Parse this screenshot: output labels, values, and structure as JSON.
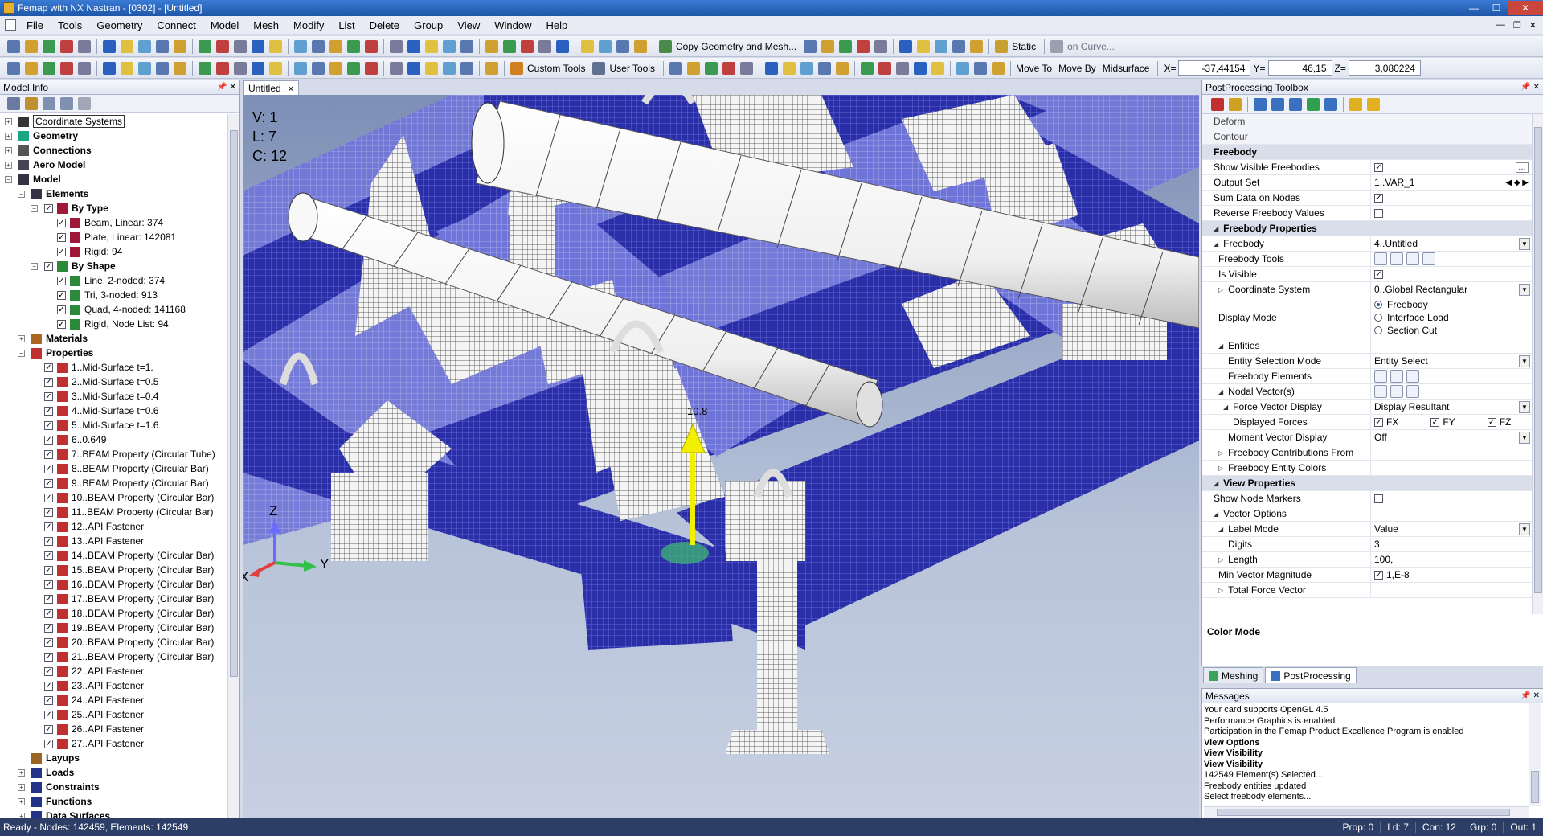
{
  "window": {
    "title": "Femap with NX Nastran - [0302] - [Untitled]"
  },
  "menu": [
    "File",
    "Tools",
    "Geometry",
    "Connect",
    "Model",
    "Mesh",
    "Modify",
    "List",
    "Delete",
    "Group",
    "View",
    "Window",
    "Help"
  ],
  "toolbar": {
    "copy_geometry": "Copy Geometry and Mesh...",
    "static": "Static",
    "on_curve": "on Curve...",
    "custom_tools": "Custom Tools",
    "user_tools": "User Tools",
    "move_to": "Move To",
    "move_by": "Move By",
    "midsurface": "Midsurface",
    "x_label": "X=",
    "x_value": "-37,44154",
    "y_label": "Y=",
    "y_value": "46,15",
    "z_label": "Z=",
    "z_value": "3,080224"
  },
  "model_info": {
    "title": "Model Info",
    "tree": [
      {
        "level": 0,
        "exp": "+",
        "label": "Coordinate Systems",
        "bold": false,
        "box": true,
        "icon": "coord-icon",
        "color": "#333"
      },
      {
        "level": 0,
        "exp": "+",
        "label": "Geometry",
        "bold": true,
        "icon": "geometry-icon",
        "color": "#1aa884"
      },
      {
        "level": 0,
        "exp": "+",
        "label": "Connections",
        "bold": true,
        "icon": "connections-icon",
        "color": "#555"
      },
      {
        "level": 0,
        "exp": "+",
        "label": "Aero Model",
        "bold": true,
        "icon": "aero-icon",
        "color": "#445"
      },
      {
        "level": 0,
        "exp": "-",
        "label": "Model",
        "bold": true,
        "icon": "model-icon",
        "color": "#334"
      },
      {
        "level": 1,
        "exp": "-",
        "label": "Elements",
        "bold": true,
        "icon": "elements-icon",
        "color": "#334"
      },
      {
        "level": 2,
        "exp": "-",
        "label": "By Type",
        "bold": true,
        "icon": "by-type-icon",
        "color": "#a01838",
        "cb": true
      },
      {
        "level": 3,
        "label": "Beam, Linear: 374",
        "cb": true,
        "icon": "beam-icon",
        "color": "#a01838"
      },
      {
        "level": 3,
        "label": "Plate, Linear: 142081",
        "cb": true,
        "icon": "plate-icon",
        "color": "#a01838"
      },
      {
        "level": 3,
        "label": "Rigid: 94",
        "cb": true,
        "icon": "rigid-icon",
        "color": "#a01838"
      },
      {
        "level": 2,
        "exp": "-",
        "label": "By Shape",
        "bold": true,
        "icon": "by-shape-icon",
        "color": "#2a8a3a",
        "cb": true
      },
      {
        "level": 3,
        "label": "Line, 2-noded: 374",
        "cb": true,
        "icon": "line-shape-icon",
        "color": "#2a8a3a"
      },
      {
        "level": 3,
        "label": "Tri,  3-noded: 913",
        "cb": true,
        "icon": "tri-shape-icon",
        "color": "#2a8a3a"
      },
      {
        "level": 3,
        "label": "Quad, 4-noded: 141168",
        "cb": true,
        "icon": "quad-shape-icon",
        "color": "#2a8a3a"
      },
      {
        "level": 3,
        "label": "Rigid, Node List: 94",
        "cb": true,
        "icon": "rigid-shape-icon",
        "color": "#2a8a3a"
      },
      {
        "level": 1,
        "exp": "+",
        "label": "Materials",
        "bold": true,
        "icon": "materials-icon",
        "color": "#aa6622"
      },
      {
        "level": 1,
        "exp": "-",
        "label": "Properties",
        "bold": true,
        "icon": "properties-icon",
        "color": "#c03030"
      },
      {
        "level": 2,
        "label": "1..Mid-Surface t=1.",
        "cb": true,
        "icon": "plate-prop-icon",
        "color": "#c03030"
      },
      {
        "level": 2,
        "label": "2..Mid-Surface t=0.5",
        "cb": true,
        "icon": "plate-prop-icon",
        "color": "#c03030"
      },
      {
        "level": 2,
        "label": "3..Mid-Surface t=0.4",
        "cb": true,
        "icon": "plate-prop-icon",
        "color": "#c03030"
      },
      {
        "level": 2,
        "label": "4..Mid-Surface t=0.6",
        "cb": true,
        "icon": "plate-prop-icon",
        "color": "#c03030"
      },
      {
        "level": 2,
        "label": "5..Mid-Surface t=1.6",
        "cb": true,
        "icon": "plate-prop-icon",
        "color": "#c03030"
      },
      {
        "level": 2,
        "label": "6..0.649",
        "cb": true,
        "icon": "plate-prop-icon",
        "color": "#c03030"
      },
      {
        "level": 2,
        "label": "7..BEAM Property (Circular Tube)",
        "cb": true,
        "icon": "tube-prop-icon",
        "color": "#c03030"
      },
      {
        "level": 2,
        "label": "8..BEAM Property (Circular Bar)",
        "cb": true,
        "icon": "bar-prop-icon",
        "color": "#c03030"
      },
      {
        "level": 2,
        "label": "9..BEAM Property (Circular Bar)",
        "cb": true,
        "icon": "bar-prop-icon",
        "color": "#c03030"
      },
      {
        "level": 2,
        "label": "10..BEAM Property (Circular Bar)",
        "cb": true,
        "icon": "bar-prop-icon",
        "color": "#c03030"
      },
      {
        "level": 2,
        "label": "11..BEAM Property (Circular Bar)",
        "cb": true,
        "icon": "bar-prop-icon",
        "color": "#c03030"
      },
      {
        "level": 2,
        "label": "12..API Fastener",
        "cb": true,
        "icon": "fastener-prop-icon",
        "color": "#c03030"
      },
      {
        "level": 2,
        "label": "13..API Fastener",
        "cb": true,
        "icon": "fastener-prop-icon",
        "color": "#c03030"
      },
      {
        "level": 2,
        "label": "14..BEAM Property (Circular Bar)",
        "cb": true,
        "icon": "bar-prop-icon",
        "color": "#c03030"
      },
      {
        "level": 2,
        "label": "15..BEAM Property (Circular Bar)",
        "cb": true,
        "icon": "bar-prop-icon",
        "color": "#c03030"
      },
      {
        "level": 2,
        "label": "16..BEAM Property (Circular Bar)",
        "cb": true,
        "icon": "bar-prop-icon",
        "color": "#c03030"
      },
      {
        "level": 2,
        "label": "17..BEAM Property (Circular Bar)",
        "cb": true,
        "icon": "bar-prop-icon",
        "color": "#c03030"
      },
      {
        "level": 2,
        "label": "18..BEAM Property (Circular Bar)",
        "cb": true,
        "icon": "bar-prop-icon",
        "color": "#c03030"
      },
      {
        "level": 2,
        "label": "19..BEAM Property (Circular Bar)",
        "cb": true,
        "icon": "bar-prop-icon",
        "color": "#c03030"
      },
      {
        "level": 2,
        "label": "20..BEAM Property (Circular Bar)",
        "cb": true,
        "icon": "bar-prop-icon",
        "color": "#c03030"
      },
      {
        "level": 2,
        "label": "21..BEAM Property (Circular Bar)",
        "cb": true,
        "icon": "bar-prop-icon",
        "color": "#c03030"
      },
      {
        "level": 2,
        "label": "22..API Fastener",
        "cb": true,
        "icon": "fastener-prop-icon",
        "color": "#c03030"
      },
      {
        "level": 2,
        "label": "23..API Fastener",
        "cb": true,
        "icon": "fastener-prop-icon",
        "color": "#c03030"
      },
      {
        "level": 2,
        "label": "24..API Fastener",
        "cb": true,
        "icon": "fastener-prop-icon",
        "color": "#c03030"
      },
      {
        "level": 2,
        "label": "25..API Fastener",
        "cb": true,
        "icon": "fastener-prop-icon",
        "color": "#c03030"
      },
      {
        "level": 2,
        "label": "26..API Fastener",
        "cb": true,
        "icon": "fastener-prop-icon",
        "color": "#c03030"
      },
      {
        "level": 2,
        "label": "27..API Fastener",
        "cb": true,
        "icon": "fastener-prop-icon",
        "color": "#c03030"
      },
      {
        "level": 1,
        "label": "Layups",
        "bold": true,
        "icon": "layups-icon",
        "color": "#996622"
      },
      {
        "level": 1,
        "exp": "+",
        "label": "Loads",
        "bold": true,
        "icon": "loads-icon",
        "color": "#223388"
      },
      {
        "level": 1,
        "exp": "+",
        "label": "Constraints",
        "bold": true,
        "icon": "constraints-icon",
        "color": "#223388"
      },
      {
        "level": 1,
        "exp": "+",
        "label": "Functions",
        "bold": true,
        "icon": "functions-icon",
        "color": "#223388"
      },
      {
        "level": 1,
        "exp": "+",
        "label": "Data Surfaces",
        "bold": true,
        "icon": "data-surfaces-icon",
        "color": "#223388"
      }
    ]
  },
  "viewport": {
    "tab": "Untitled",
    "v": "V: 1",
    "l": "L: 7",
    "c": "C: 12",
    "vector_label": "10.8",
    "axis_x": "X",
    "axis_y": "Y",
    "axis_z": "Z"
  },
  "postprocessing": {
    "title": "PostProcessing Toolbox",
    "rows": [
      {
        "type": "cat",
        "label": "Deform"
      },
      {
        "type": "cat",
        "label": "Contour"
      },
      {
        "type": "sec",
        "label": "Freebody"
      },
      {
        "type": "row",
        "label": "Show Visible Freebodies",
        "check": true,
        "extra": "..."
      },
      {
        "type": "row",
        "label": "Output Set",
        "value": "1..VAR_1",
        "arrows": true
      },
      {
        "type": "row",
        "label": "Sum Data on Nodes",
        "check": true
      },
      {
        "type": "row",
        "label": "Reverse Freebody Values",
        "check": false
      },
      {
        "type": "sec",
        "label": "Freebody Properties",
        "tri": "◢"
      },
      {
        "type": "row",
        "label": "Freebody",
        "value": "4..Untitled",
        "dd": true,
        "tri": "◢"
      },
      {
        "type": "row",
        "label": "Freebody Tools",
        "indent": 1,
        "tools": 4
      },
      {
        "type": "row",
        "label": "Is Visible",
        "indent": 1,
        "check": true
      },
      {
        "type": "row",
        "label": "Coordinate System",
        "indent": 1,
        "value": "0..Global Rectangular",
        "dd": true,
        "tri": "▷"
      },
      {
        "type": "radio",
        "label": "Display Mode",
        "indent": 1,
        "options": [
          "Freebody",
          "Interface Load",
          "Section Cut"
        ],
        "selected": 0
      },
      {
        "type": "row",
        "label": "Entities",
        "indent": 1,
        "tri": "◢"
      },
      {
        "type": "row",
        "label": "Entity Selection Mode",
        "indent": 3,
        "value": "Entity Select",
        "dd": true
      },
      {
        "type": "row",
        "label": "Freebody Elements",
        "indent": 3,
        "tools": 3
      },
      {
        "type": "row",
        "label": "Nodal Vector(s)",
        "indent": 1,
        "tri": "◢",
        "tools": 3
      },
      {
        "type": "row",
        "label": "Force Vector Display",
        "indent": 2,
        "value": "Display Resultant",
        "dd": true,
        "tri": "◢"
      },
      {
        "type": "forces",
        "label": "Displayed Forces",
        "indent": 4,
        "items": [
          "FX",
          "FY",
          "FZ"
        ]
      },
      {
        "type": "row",
        "label": "Moment Vector Display",
        "indent": 3,
        "value": "Off",
        "dd": true
      },
      {
        "type": "row",
        "label": "Freebody Contributions From",
        "indent": 1,
        "tri": "▷"
      },
      {
        "type": "row",
        "label": "Freebody Entity Colors",
        "indent": 1,
        "tri": "▷"
      },
      {
        "type": "sec",
        "label": "View Properties",
        "tri": "◢"
      },
      {
        "type": "row",
        "label": "Show Node Markers",
        "check": false
      },
      {
        "type": "row",
        "label": "Vector Options",
        "tri": "◢"
      },
      {
        "type": "row",
        "label": "Label Mode",
        "indent": 1,
        "value": "Value",
        "dd": true,
        "tri": "◢"
      },
      {
        "type": "row",
        "label": "Digits",
        "indent": 3,
        "value": "3"
      },
      {
        "type": "row",
        "label": "Length",
        "indent": 1,
        "value": "100,",
        "tri": "▷"
      },
      {
        "type": "row",
        "label": "Min Vector Magnitude",
        "indent": 1,
        "value": "1,E-8",
        "check": true
      },
      {
        "type": "row",
        "label": "Total Force Vector",
        "indent": 1,
        "tri": "▷"
      }
    ],
    "color_mode": "Color Mode",
    "tabs": [
      "Meshing",
      "PostProcessing"
    ]
  },
  "messages": {
    "title": "Messages",
    "lines": [
      {
        "t": "Your card supports OpenGL 4.5",
        "b": false
      },
      {
        "t": "Performance Graphics is enabled",
        "b": false
      },
      {
        "t": "Participation in the Femap Product Excellence Program is enabled",
        "b": false
      },
      {
        "t": "View Options",
        "b": true
      },
      {
        "t": "View Visibility",
        "b": true
      },
      {
        "t": "View Visibility",
        "b": true
      },
      {
        "t": "142549 Element(s) Selected...",
        "b": false
      },
      {
        "t": "Freebody entities updated",
        "b": false
      },
      {
        "t": "Select freebody elements...",
        "b": false
      }
    ]
  },
  "status": {
    "left": "Ready - Nodes: 142459,  Elements: 142549",
    "prop": "Prop: 0",
    "ld": "Ld: 7",
    "con": "Con: 12",
    "grp": "Grp: 0",
    "out": "Out: 1"
  },
  "colors": {
    "mesh_blue": "#2a2fa8",
    "mesh_light": "#6a6fe0",
    "vector": "#f2ef00",
    "accent": "#1f57a8"
  }
}
